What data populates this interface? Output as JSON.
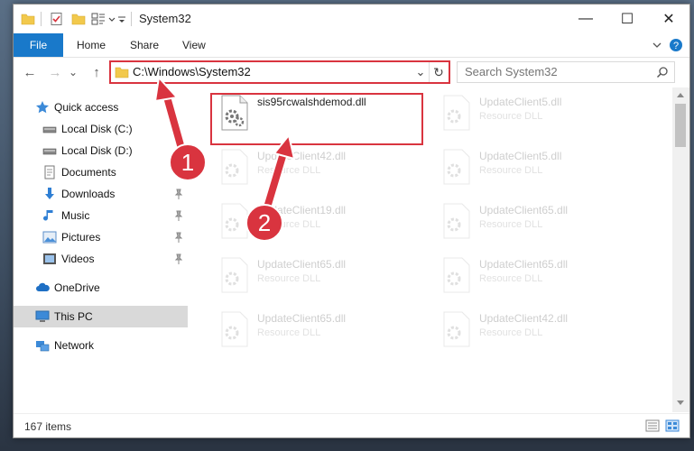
{
  "window": {
    "title": "System32",
    "minimize": "—",
    "maximize": "☐",
    "close": "✕"
  },
  "ribbon": {
    "tabs": [
      "File",
      "Home",
      "Share",
      "View"
    ]
  },
  "nav": {
    "back": "←",
    "forward": "→",
    "recent": "⌄",
    "up": "↑",
    "address": "C:\\Windows\\System32",
    "dropdown": "⌄",
    "refresh": "↻",
    "search_placeholder": "Search System32"
  },
  "sidebar": {
    "items": [
      {
        "label": "Quick access",
        "icon": "star-icon",
        "pinned": false
      },
      {
        "label": "Local Disk (C:)",
        "icon": "drive-icon",
        "pinned": false
      },
      {
        "label": "Local Disk (D:)",
        "icon": "drive-icon",
        "pinned": false
      },
      {
        "label": "Documents",
        "icon": "documents-icon",
        "pinned": false
      },
      {
        "label": "Downloads",
        "icon": "download-icon",
        "pinned": true
      },
      {
        "label": "Music",
        "icon": "music-icon",
        "pinned": true
      },
      {
        "label": "Pictures",
        "icon": "pictures-icon",
        "pinned": true
      },
      {
        "label": "Videos",
        "icon": "videos-icon",
        "pinned": true
      },
      {
        "label": "OneDrive",
        "icon": "cloud-icon",
        "pinned": false
      },
      {
        "label": "This PC",
        "icon": "computer-icon",
        "pinned": false,
        "selected": true
      },
      {
        "label": "Network",
        "icon": "network-icon",
        "pinned": false
      }
    ]
  },
  "files": [
    {
      "name": "sis95rcwalshdemod.dll",
      "type": "",
      "faded": false
    },
    {
      "name": "UpdateClient5.dll",
      "type": "Resource DLL",
      "faded": true
    },
    {
      "name": "UpdateClient42.dll",
      "type": "Resource DLL",
      "faded": true
    },
    {
      "name": "UpdateClient5.dll",
      "type": "Resource DLL",
      "faded": true
    },
    {
      "name": "UpdateClient19.dll",
      "type": "Resource DLL",
      "faded": true
    },
    {
      "name": "UpdateClient65.dll",
      "type": "Resource DLL",
      "faded": true
    },
    {
      "name": "UpdateClient65.dll",
      "type": "Resource DLL",
      "faded": true
    },
    {
      "name": "UpdateClient65.dll",
      "type": "Resource DLL",
      "faded": true
    },
    {
      "name": "UpdateClient65.dll",
      "type": "Resource DLL",
      "faded": true
    },
    {
      "name": "UpdateClient42.dll",
      "type": "Resource DLL",
      "faded": true
    }
  ],
  "status": {
    "item_count": "167 items"
  },
  "annotations": {
    "step1": "1",
    "step2": "2",
    "color": "#d9343f"
  },
  "colors": {
    "accent": "#1979ca",
    "highlight": "#d9343f",
    "selected": "#d9d9d9"
  }
}
